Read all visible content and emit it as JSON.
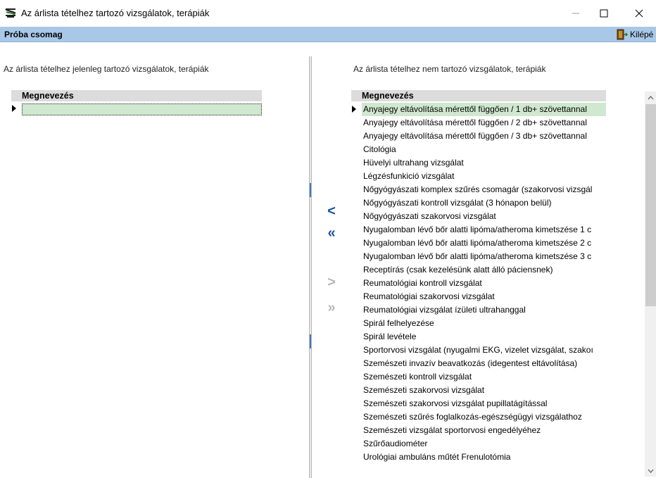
{
  "window": {
    "title": "Az árlista tételhez tartozó vizsgálatok, terápiák",
    "app_icon": "app-glyph-icon",
    "minimize_icon": "minimize-icon",
    "maximize_icon": "maximize-icon",
    "close_icon": "close-icon"
  },
  "toolbar": {
    "package_name": "Próba csomag",
    "exit_label": "Kilépé",
    "exit_icon": "exit-door-icon"
  },
  "left_panel": {
    "caption": "Az árlista tételhez jelenleg tartozó vizsgálatok, terápiák",
    "column_header": "Megnevezés",
    "rows": []
  },
  "right_panel": {
    "caption": "Az árlista tételhez nem tartozó vizsgálatok, terápiák",
    "column_header": "Megnevezés",
    "rows": [
      "Anyajegy eltávolítása mérettől függően / 1 db+ szövettannal",
      "Anyajegy eltávolítása mérettől függően / 2 db+ szövettannal",
      "Anyajegy eltávolítása mérettől függően / 3 db+ szövettannal",
      "Citológia",
      "Hüvelyi ultrahang vizsgálat",
      "Légzésfunkició vizsgálat",
      "Nőgyógyászati komplex szűrés csomagár (szakorvosi vizsgál",
      "Nőgyógyászati kontroll vizsgálat (3 hónapon belül)",
      "Nőgyógyászati szakorvosi vizsgálat",
      "Nyugalomban lévő bőr alatti lipóma/atheroma kimetszése 1 c",
      "Nyugalomban lévő bőr alatti lipóma/atheroma kimetszése 2 c",
      "Nyugalomban lévő bőr alatti lipóma/atheroma kimetszése 3 c",
      "Receptírás (csak kezelésünk alatt álló páciensnek)",
      "Reumatológiai kontroll vizsgálat",
      "Reumatológiai szakorvosi vizsgálat",
      "Reumatológiai vizsgálat ízületi ultrahanggal",
      "Spirál felhelyezése",
      "Spirál levétele",
      "Sportorvosi vizsgálat (nyugalmi EKG, vizelet vizsgálat, szakoı",
      "Szemészeti invazív beavatkozás (idegentest eltávolítása)",
      "Szemészeti kontroll vizsgálat",
      "Szemészeti szakorvosi vizsgálat",
      "Szemészeti szakorvosi vizsgálat pupillatágítással",
      "Szemészeti szűrés foglalkozás-egészségügyi vizsgálathoz",
      "Szemészeti vizsgálat sportorvosi engedélyéhez",
      "Szűrőaudiométer",
      "Urológiai ambuláns műtét Frenulotómia"
    ],
    "selected_index": 0
  },
  "move_buttons": {
    "add_one": {
      "glyph": "<",
      "enabled": true
    },
    "add_all": {
      "glyph": "«",
      "enabled": true
    },
    "remove_one": {
      "glyph": ">",
      "enabled": false
    },
    "remove_all": {
      "glyph": "»",
      "enabled": false
    }
  },
  "colors": {
    "toolbar_bg": "#a9c8e8",
    "selection_bg": "#cfe8cf",
    "button_enabled": "#1b4fa0",
    "button_disabled": "#b8b8b8"
  }
}
